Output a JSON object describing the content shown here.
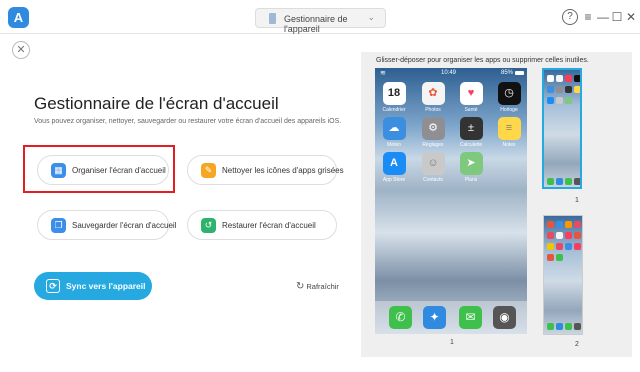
{
  "titlebar": {
    "logo_letter": "A",
    "device_selector": "Gestionnaire de l'appareil",
    "help": "?",
    "menu": "≡",
    "minimize": "—",
    "maximize": "☐",
    "close": "✕"
  },
  "close_button": "✕",
  "main": {
    "heading": "Gestionnaire de l'écran d'accueil",
    "subtitle": "Vous pouvez organiser, nettoyer, sauvegarder ou restaurer votre écran d'accueil des appareils iOS.",
    "actions": [
      {
        "label": "Organiser l'écran d'accueil",
        "icon": "grid-icon",
        "color": "#3b8fe8"
      },
      {
        "label": "Nettoyer les icônes d'apps grisées",
        "icon": "broom-icon",
        "color": "#f5a623"
      },
      {
        "label": "Sauvegarder l'écran d'accueil",
        "icon": "backup-icon",
        "color": "#3b8fe8"
      },
      {
        "label": "Restaurer l'écran d'accueil",
        "icon": "restore-icon",
        "color": "#2db36b"
      }
    ],
    "sync_button": "Sync vers l'appareil",
    "refresh": "Rafraîchir"
  },
  "preview": {
    "hint": "Glisser-déposer pour organiser les apps ou supprimer celles inutiles.",
    "status": {
      "time": "10:49",
      "battery": "85%"
    },
    "apps": [
      {
        "label": "Calendrier",
        "glyph": "18",
        "color": "#ffffff"
      },
      {
        "label": "Photos",
        "glyph": "✿",
        "color": "#f4f4f4"
      },
      {
        "label": "Santé",
        "glyph": "♥",
        "color": "#ffffff"
      },
      {
        "label": "Horloge",
        "glyph": "◷",
        "color": "#111111"
      },
      {
        "label": "Météo",
        "glyph": "☁",
        "color": "#3c8fe0"
      },
      {
        "label": "Réglages",
        "glyph": "⚙",
        "color": "#8e8e93"
      },
      {
        "label": "Calculette",
        "glyph": "±",
        "color": "#333333"
      },
      {
        "label": "Notes",
        "glyph": "≡",
        "color": "#ffd84a"
      },
      {
        "label": "App Store",
        "glyph": "A",
        "color": "#1a8cf5"
      },
      {
        "label": "Contacts",
        "glyph": "☺",
        "color": "#c9c9c9"
      },
      {
        "label": "Plans",
        "glyph": "➤",
        "color": "#7fc97f"
      }
    ],
    "dock": [
      {
        "name": "Téléphone",
        "glyph": "✆",
        "color": "#3fc04c"
      },
      {
        "name": "Safari",
        "glyph": "✦",
        "color": "#2f8ae0"
      },
      {
        "name": "Messages",
        "glyph": "✉",
        "color": "#3fc04c"
      },
      {
        "name": "Appareil photo",
        "glyph": "◉",
        "color": "#555555"
      }
    ],
    "page_current": "1",
    "thumbs": [
      "1",
      "2"
    ]
  }
}
